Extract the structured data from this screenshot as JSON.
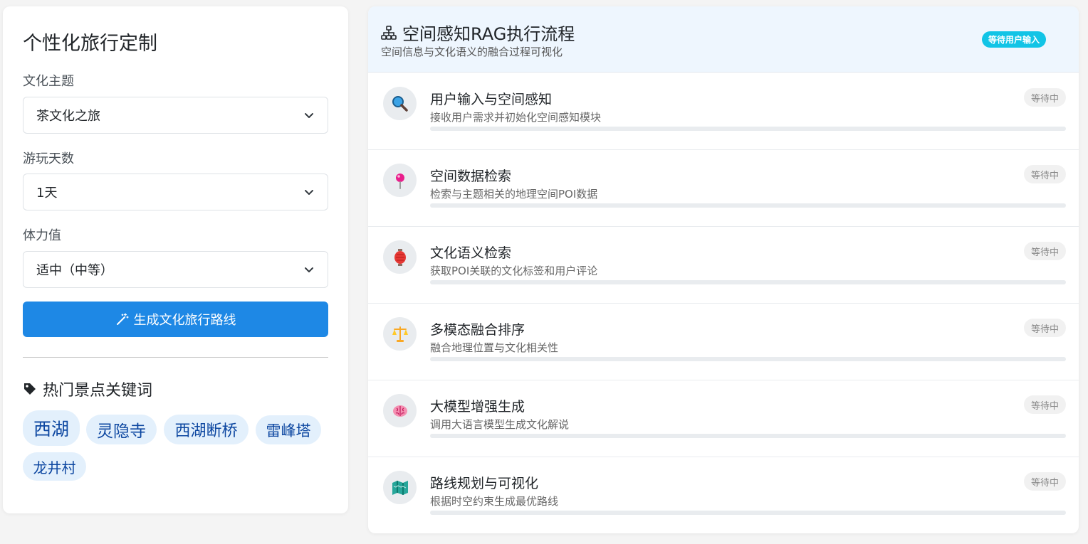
{
  "left": {
    "title": "个性化旅行定制",
    "theme": {
      "label": "文化主题",
      "value": "茶文化之旅"
    },
    "days": {
      "label": "游玩天数",
      "value": "1天"
    },
    "stamina": {
      "label": "体力值",
      "value": "适中（中等）"
    },
    "generate_label": "生成文化旅行路线",
    "keywords_title": "热门景点关键词",
    "keywords": [
      "西湖",
      "灵隐寺",
      "西湖断桥",
      "雷峰塔",
      "龙井村"
    ]
  },
  "right": {
    "title": "空间感知RAG执行流程",
    "subtitle": "空间信息与文化语义的融合过程可视化",
    "badge": "等待用户输入",
    "steps": [
      {
        "icon": "magnifier-icon",
        "title": "用户输入与空间感知",
        "desc": "接收用户需求并初始化空间感知模块",
        "status": "等待中",
        "progress": 0
      },
      {
        "icon": "map-pin-icon",
        "title": "空间数据检索",
        "desc": "检索与主题相关的地理空间POI数据",
        "status": "等待中",
        "progress": 0
      },
      {
        "icon": "lantern-icon",
        "title": "文化语义检索",
        "desc": "获取POI关联的文化标签和用户评论",
        "status": "等待中",
        "progress": 0
      },
      {
        "icon": "scales-icon",
        "title": "多模态融合排序",
        "desc": "融合地理位置与文化相关性",
        "status": "等待中",
        "progress": 0
      },
      {
        "icon": "brain-icon",
        "title": "大模型增强生成",
        "desc": "调用大语言模型生成文化解说",
        "status": "等待中",
        "progress": 0
      },
      {
        "icon": "map-icon",
        "title": "路线规划与可视化",
        "desc": "根据时空约束生成最优路线",
        "status": "等待中",
        "progress": 0
      }
    ]
  },
  "colors": {
    "primary": "#1e88e5",
    "badge": "#12c4e6",
    "tag_bg": "#e3f0fc",
    "tag_text": "#0d47a1"
  }
}
